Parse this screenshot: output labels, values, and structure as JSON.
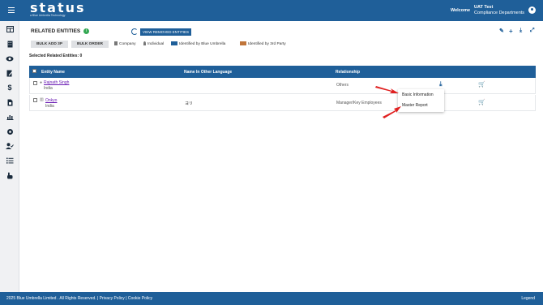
{
  "header": {
    "logo": "status",
    "logo_tagline": "a Blue Umbrella Technology",
    "welcome": "Welcome",
    "user_name": "UAT Test",
    "user_dept": "Compliance Departments"
  },
  "page": {
    "title": "RELATED ENTITIES",
    "info_badge": "i",
    "view_removed": "VIEW REMOVED ENTITIES",
    "bulk_add": "BULK ADD 3P",
    "bulk_order": "BULK ORDER",
    "selected_label": "Selected Related Entities: 0"
  },
  "legend": [
    {
      "label": "Company",
      "icon": "building-icon",
      "color": "#777777"
    },
    {
      "label": "Individual",
      "icon": "person-icon",
      "color": "#777777"
    },
    {
      "label": "Identified by Blue Umbrella",
      "icon": "building-person-blue-icon",
      "color": "#1f5f99"
    },
    {
      "label": "Identified by 3rd Party",
      "icon": "building-person-orange-icon",
      "color": "#c0753a"
    }
  ],
  "table": {
    "columns": [
      "Entity Name",
      "Name In Other Language",
      "Relationship"
    ],
    "rows": [
      {
        "name": "Rajnath Singh",
        "country": "India",
        "other_lang": "",
        "relationship": "Others",
        "type_icon": "person-icon"
      },
      {
        "name": "Onkyo",
        "country": "India",
        "other_lang": "ヨリ",
        "relationship": "Manager/Key Employees",
        "type_icon": "building-icon"
      }
    ]
  },
  "popup": {
    "items": [
      "Basic Information",
      "Master Report"
    ]
  },
  "footer": {
    "copyright": "2025 Blue Umbrella Limited . All Rights Reserved. | Privacy Policy | Cookie Policy",
    "legend": "Legend"
  },
  "colors": {
    "brand": "#1f5f99",
    "link": "#6a1bb3",
    "arrow": "#e02020"
  }
}
